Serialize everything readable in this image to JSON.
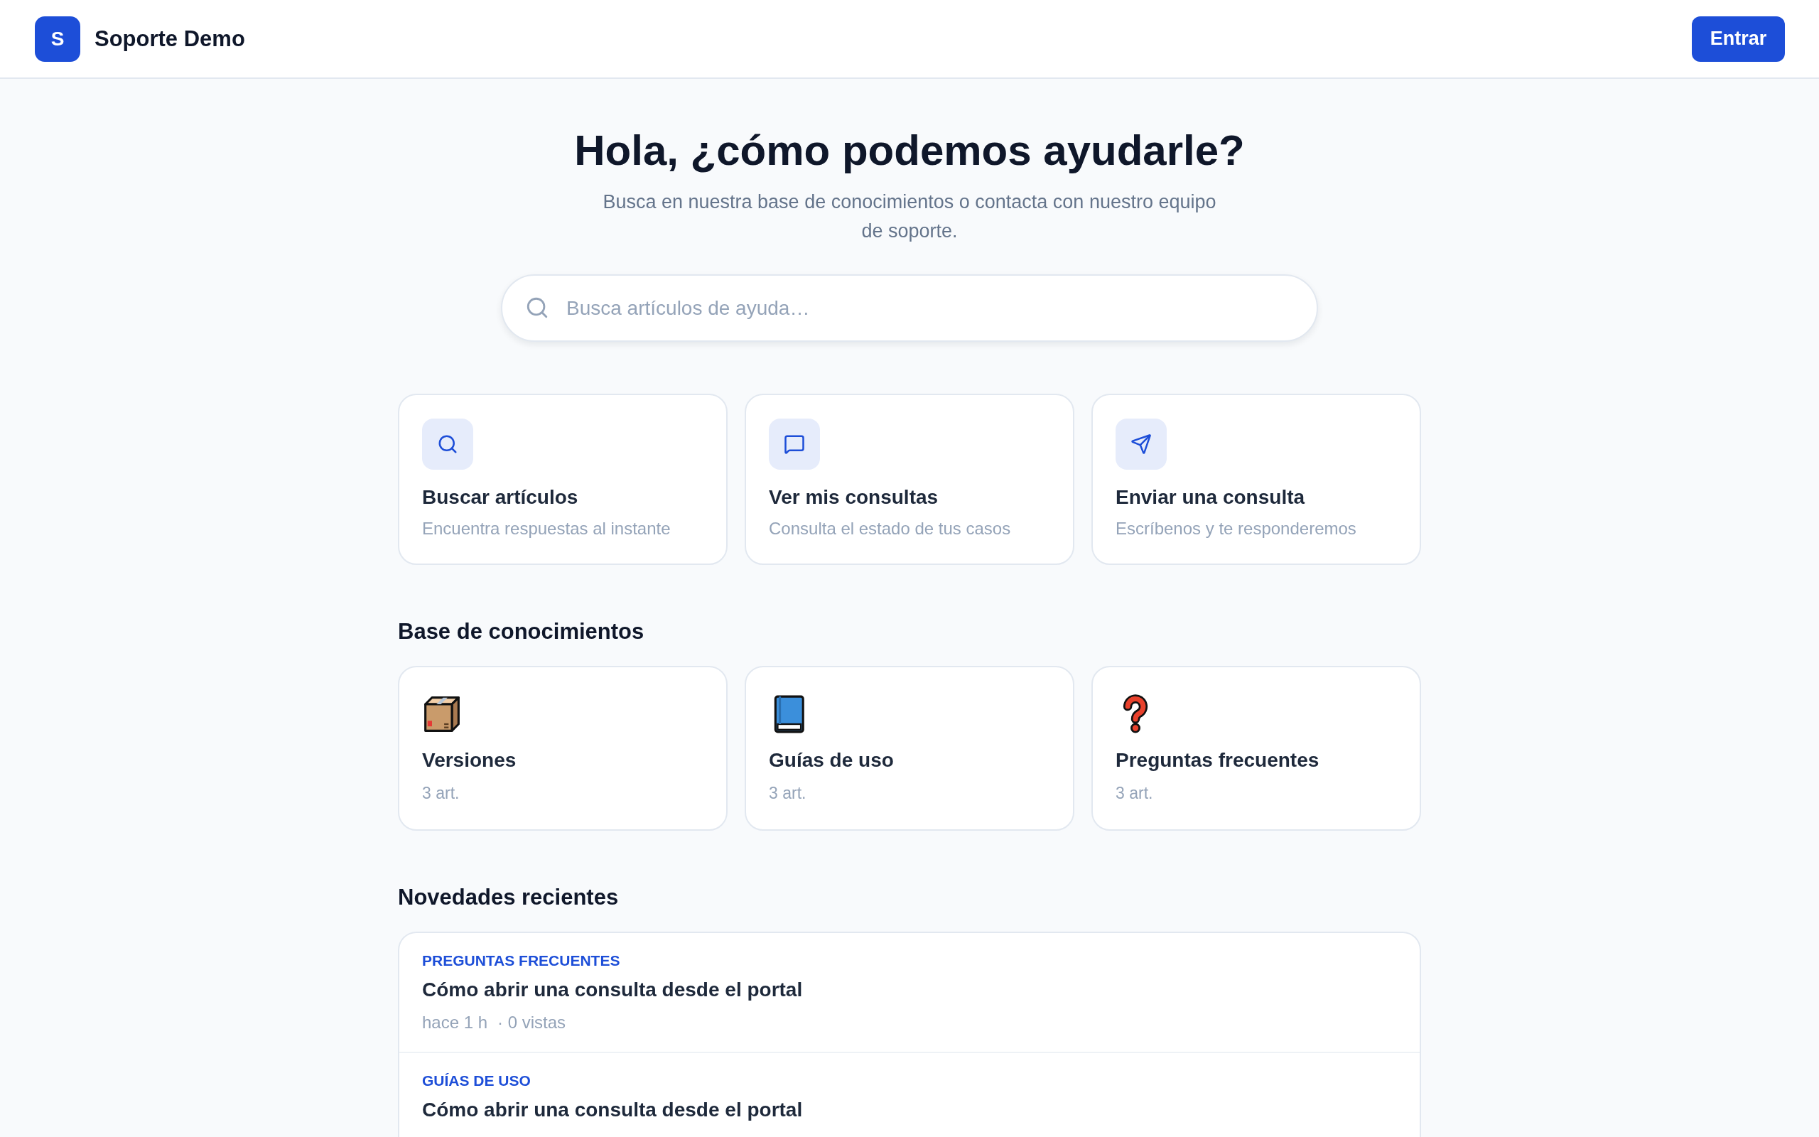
{
  "header": {
    "logo": "S",
    "brand": "Soporte Demo",
    "login_button": "Entrar"
  },
  "hero": {
    "title": "Hola, ¿cómo podemos ayudarle?",
    "subtitle": "Busca en nuestra base de conocimientos o contacta con nuestro equipo de soporte.",
    "search": {
      "placeholder": "Busca artículos de ayuda…"
    }
  },
  "actions": [
    {
      "title": "Buscar artículos",
      "description": "Encuentra respuestas al instante"
    },
    {
      "title": "Ver mis consultas",
      "description": "Consulta el estado de tus casos"
    },
    {
      "title": "Enviar una consulta",
      "description": "Escríbenos y te responderemos"
    }
  ],
  "knowledge_base": {
    "title": "Base de conocimientos",
    "categories": [
      {
        "title": "Versiones",
        "count": "3 art."
      },
      {
        "title": "Guías de uso",
        "count": "3 art."
      },
      {
        "title": "Preguntas frecuentes",
        "count": "3 art."
      }
    ]
  },
  "recent": {
    "title": "Novedades recientes",
    "articles": [
      {
        "category": "PREGUNTAS FRECUENTES",
        "title": "Cómo abrir una consulta desde el portal",
        "time": "hace 1 h",
        "views": "· 0 vistas"
      },
      {
        "category": "GUÍAS DE USO",
        "title": "Cómo abrir una consulta desde el portal"
      }
    ]
  }
}
